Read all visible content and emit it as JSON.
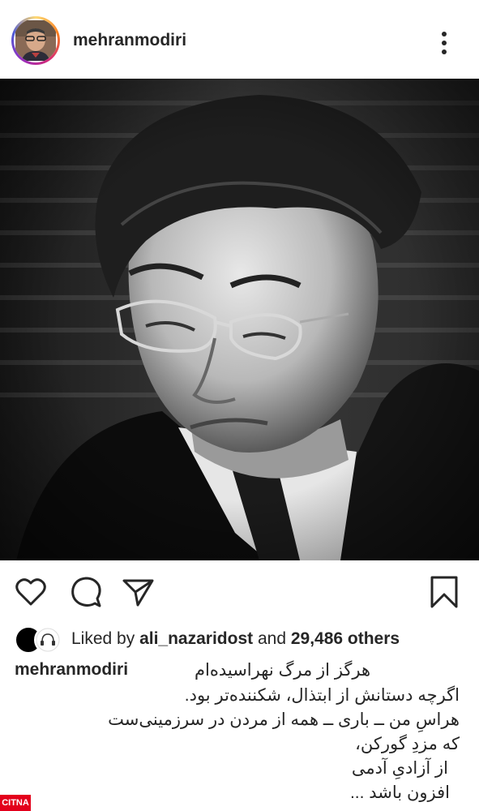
{
  "header": {
    "username": "mehranmodiri",
    "avatar_icon": "profile-photo",
    "more_icon": "more-vertical-icon"
  },
  "post": {
    "photo_icon": "portrait-photo"
  },
  "actions": {
    "like_icon": "heart-icon",
    "comment_icon": "comment-icon",
    "share_icon": "send-icon",
    "save_icon": "bookmark-icon"
  },
  "likes": {
    "prefix": "Liked by ",
    "user": "ali_nazaridost",
    "middle": " and ",
    "count": "29,486 others"
  },
  "caption": {
    "username": "mehranmodiri",
    "first_line": "هرگز از مرگ نهراسیده‌ام",
    "lines": [
      "اگرچه دستانش از ابتذال، شکننده‌تر بود.",
      "هراسِ من ــ باری ــ همه از مردن در سرزمینی‌ست",
      "که مزدِ گورکن،",
      "از آزادیِ آدمی",
      "افزون باشد ..."
    ]
  },
  "watermark": {
    "label": "CITNA"
  },
  "colors": {
    "text": "#262626",
    "watermark": "#e3001b"
  }
}
